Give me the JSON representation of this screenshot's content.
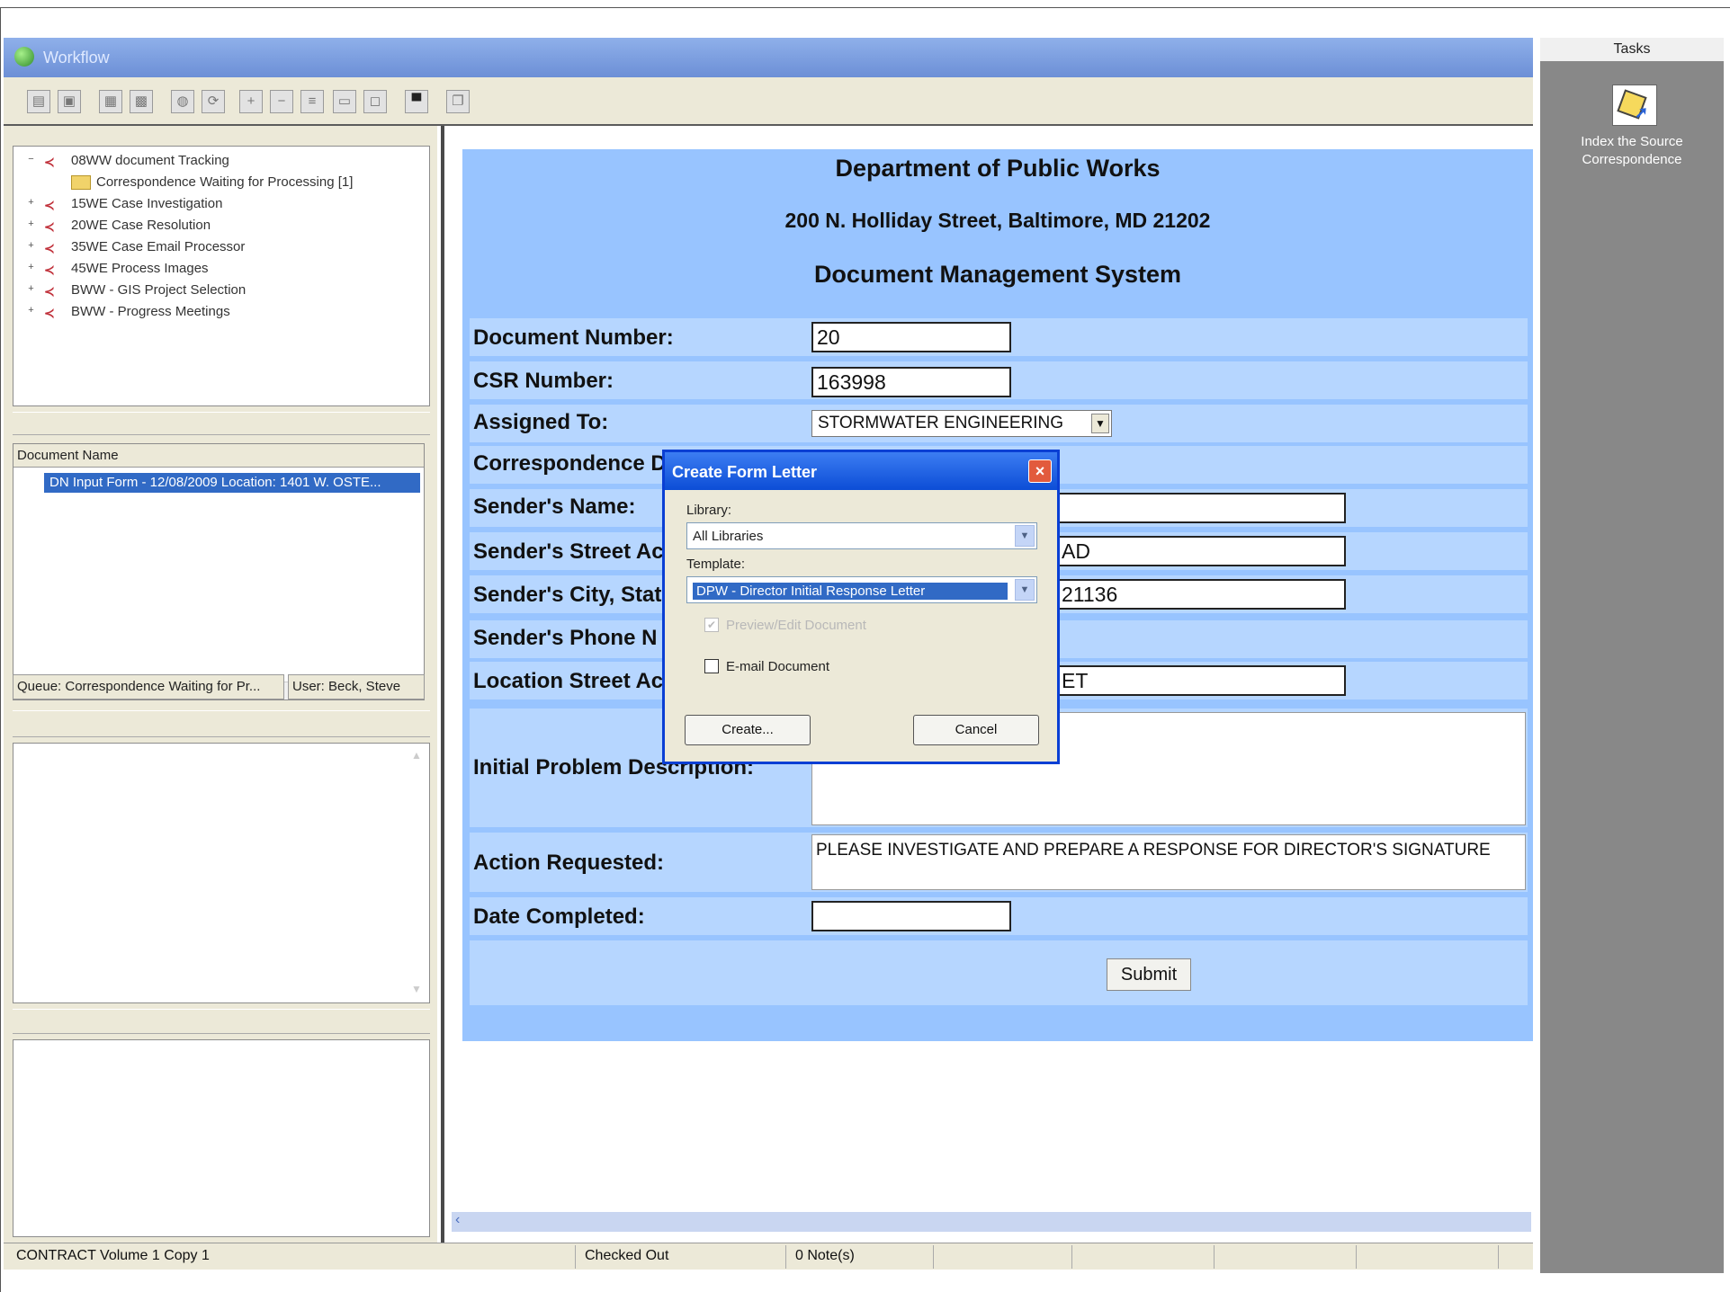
{
  "window": {
    "title": "Workflow"
  },
  "tree": {
    "items": [
      {
        "label": "08WW document Tracking",
        "expander": "−"
      },
      {
        "label": "Correspondence Waiting for Processing [1]",
        "child": true
      },
      {
        "label": "15WE Case Investigation",
        "expander": "+"
      },
      {
        "label": "20WE Case Resolution",
        "expander": "+"
      },
      {
        "label": "35WE Case Email Processor",
        "expander": "+"
      },
      {
        "label": "45WE Process Images",
        "expander": "+"
      },
      {
        "label": "BWW - GIS Project Selection",
        "expander": "+"
      },
      {
        "label": "BWW - Progress Meetings",
        "expander": "+"
      }
    ]
  },
  "documents": {
    "header": "Document Name",
    "rows": [
      "DN Input Form - 12/08/2009 Location: 1401 W. OSTE..."
    ]
  },
  "queue_status": {
    "queue": "Queue: Correspondence Waiting for Pr...",
    "user": "User: Beck, Steve"
  },
  "form": {
    "header1": "Department of Public Works",
    "header2": "200 N. Holliday Street, Baltimore, MD 21202",
    "header3": "Document Management System",
    "labels": {
      "doc_number": "Document Number:",
      "csr_number": "CSR Number:",
      "assigned_to": "Assigned To:",
      "correspondence": "Correspondence D",
      "sender_name": "Sender's Name:",
      "sender_street": "Sender's Street Ac",
      "sender_city": "Sender's City, Stat",
      "sender_phone": "Sender's Phone N",
      "location_street": "Location Street Ac",
      "initial_problem": "Initial Problem Description:",
      "action_requested": "Action Requested:",
      "date_completed": "Date Completed:"
    },
    "values": {
      "doc_number": "20",
      "csr_number": "163998",
      "assigned_to": "STORMWATER ENGINEERING",
      "sender_name": "",
      "sender_street": "AD",
      "sender_city": "21136",
      "location_street": "ET",
      "initial_problem": "",
      "action_requested": "PLEASE INVESTIGATE AND PREPARE A RESPONSE FOR DIRECTOR'S SIGNATURE",
      "date_completed": ""
    },
    "submit_label": "Submit"
  },
  "dialog": {
    "title": "Create Form Letter",
    "library_label": "Library:",
    "library_value": "All Libraries",
    "template_label": "Template:",
    "template_value": "DPW - Director Initial Response Letter",
    "preview_label": "Preview/Edit Document",
    "preview_checked": true,
    "preview_disabled": true,
    "email_label": "E-mail Document",
    "email_checked": false,
    "create_label": "Create...",
    "cancel_label": "Cancel"
  },
  "statusbar": {
    "contract": "CONTRACT Volume 1 Copy 1",
    "checked": "Checked Out",
    "notes": "0 Note(s)"
  },
  "tasks": {
    "header": "Tasks",
    "item_label": "Index the Source Correspondence",
    "icon": "index-correspondence-icon"
  }
}
